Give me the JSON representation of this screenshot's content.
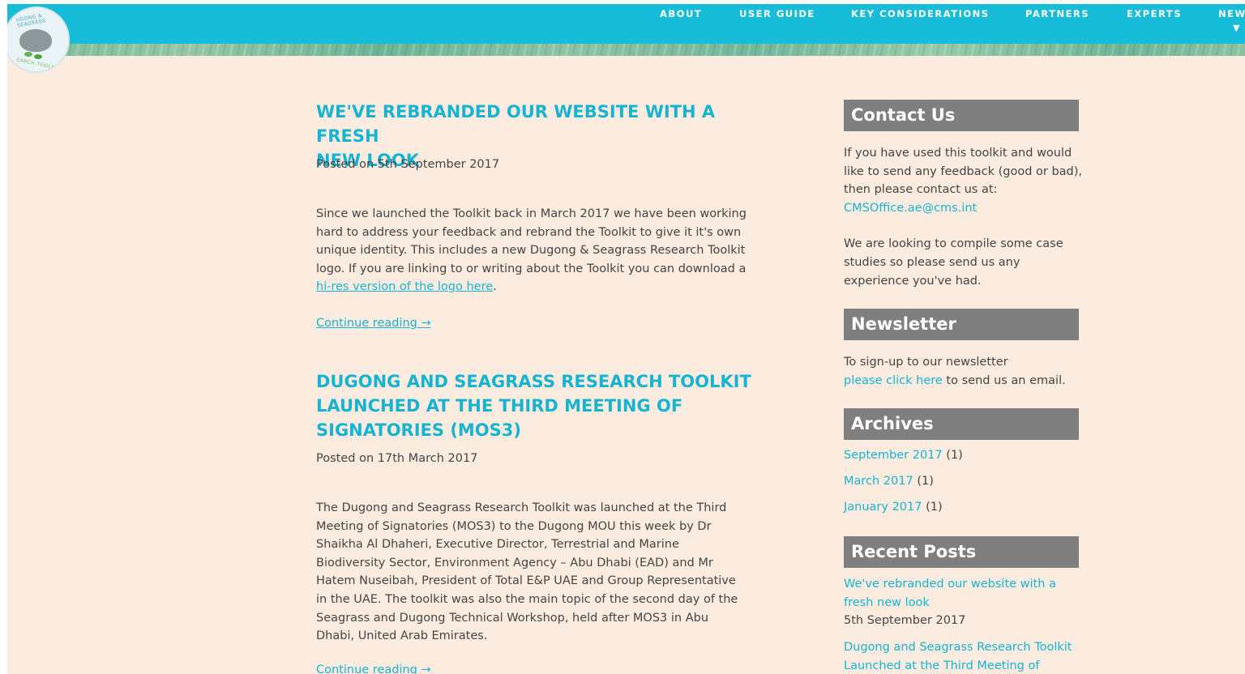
{
  "nav": {
    "items": [
      "ABOUT",
      "USER GUIDE",
      "KEY CONSIDERATIONS",
      "PARTNERS",
      "EXPERTS",
      "NEW"
    ],
    "caret": "▼"
  },
  "logo": {
    "ring_top": "UGONG & SEAGRASS",
    "ring_bottom": "EARCH TOOLKIT"
  },
  "posts": [
    {
      "title_line1": "WE'VE REBRANDED OUR WEBSITE WITH A FRESH",
      "title_line2": "NEW LOOK",
      "date": "Posted on 5th September 2017",
      "body_before_link": "Since we launched the Toolkit back in March 2017 we have been working hard to address your feedback and rebrand the Toolkit to give it it's own unique identity. This includes a new Dugong & Seagrass Research Toolkit logo. If you are linking to or writing about the Toolkit you can download a ",
      "body_link": "hi-res version of the logo here",
      "body_after_link": ".",
      "continue": "Continue reading →"
    },
    {
      "title_line1": "DUGONG AND SEAGRASS RESEARCH TOOLKIT",
      "title_line2": "LAUNCHED AT THE THIRD MEETING OF",
      "title_line3": "SIGNATORIES (MOS3)",
      "date": "Posted on 17th March 2017",
      "body": "The Dugong and Seagrass Research Toolkit was launched at the Third Meeting of Signatories (MOS3) to the Dugong MOU this week by Dr Shaikha Al Dhaheri, Executive Director, Terrestrial and Marine Biodiversity Sector, Environment Agency – Abu Dhabi (EAD) and Mr Hatem Nuseibah, President of Total E&P UAE and Group Representative in the UAE. The toolkit was also the main topic of the second day of the Seagrass and Dugong Technical Workshop, held after MOS3 in Abu Dhabi, United Arab Emirates.",
      "continue": "Continue reading →"
    }
  ],
  "sidebar": {
    "contact": {
      "title": "Contact Us",
      "text": "If you have used this toolkit and would like to send any feedback (good or bad), then please contact us at:",
      "email": "CMSOffice.ae@cms.int",
      "text2": "We are looking to compile some case studies so please send us any experience you've had."
    },
    "newsletter": {
      "title": "Newsletter",
      "text": "To sign-up to our newsletter",
      "link": "please click here",
      "text_after": " to send us an email."
    },
    "archives": {
      "title": "Archives",
      "items": [
        {
          "label": "September 2017",
          "count": " (1)"
        },
        {
          "label": "March 2017",
          "count": " (1)"
        },
        {
          "label": "January 2017",
          "count": " (1)"
        }
      ]
    },
    "recent": {
      "title": "Recent Posts",
      "items": [
        {
          "line1": "We've rebranded our website with a",
          "line2": "fresh new look",
          "date": "5th September 2017"
        },
        {
          "line1": "Dugong and Seagrass Research Toolkit",
          "line2": "Launched at the Third Meeting of"
        }
      ]
    }
  }
}
